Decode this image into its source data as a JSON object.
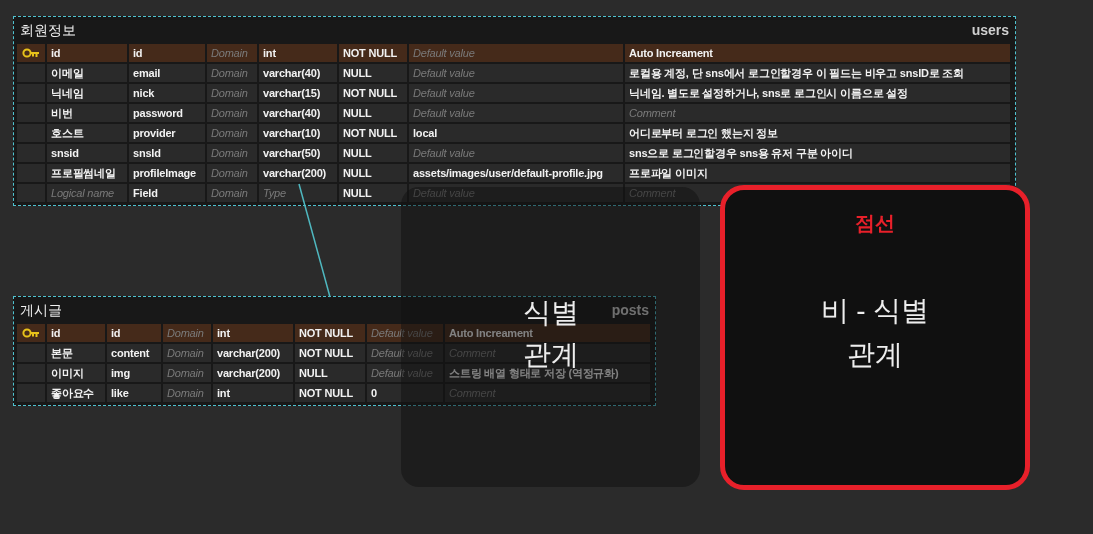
{
  "tables": [
    {
      "title": "회원정보",
      "name": "users",
      "rows": [
        {
          "primary_key": true,
          "cells": [
            {
              "text": "id"
            },
            {
              "text": "id"
            },
            {
              "text": "Domain",
              "placeholder": true
            },
            {
              "text": "int"
            },
            {
              "text": "NOT NULL"
            },
            {
              "text": "Default value",
              "placeholder": true
            },
            {
              "text": "Auto Increament"
            }
          ]
        },
        {
          "primary_key": false,
          "cells": [
            {
              "text": "이메일"
            },
            {
              "text": "email"
            },
            {
              "text": "Domain",
              "placeholder": true
            },
            {
              "text": "varchar(40)"
            },
            {
              "text": "NULL"
            },
            {
              "text": "Default value",
              "placeholder": true
            },
            {
              "text": "로컬용 계정, 단 sns에서 로그인할경우 이 필드는 비우고 snsID로 조회"
            }
          ]
        },
        {
          "primary_key": false,
          "cells": [
            {
              "text": "닉네임"
            },
            {
              "text": "nick"
            },
            {
              "text": "Domain",
              "placeholder": true
            },
            {
              "text": "varchar(15)"
            },
            {
              "text": "NOT NULL"
            },
            {
              "text": "Default value",
              "placeholder": true
            },
            {
              "text": "닉네임. 별도로 설정하거나, sns로 로그인시 이름으로 설정"
            }
          ]
        },
        {
          "primary_key": false,
          "cells": [
            {
              "text": "비번"
            },
            {
              "text": "password"
            },
            {
              "text": "Domain",
              "placeholder": true
            },
            {
              "text": "varchar(40)"
            },
            {
              "text": "NULL"
            },
            {
              "text": "Default value",
              "placeholder": true
            },
            {
              "text": "Comment",
              "placeholder": true
            }
          ]
        },
        {
          "primary_key": false,
          "cells": [
            {
              "text": "호스트"
            },
            {
              "text": "provider"
            },
            {
              "text": "Domain",
              "placeholder": true
            },
            {
              "text": "varchar(10)"
            },
            {
              "text": "NOT NULL"
            },
            {
              "text": "local"
            },
            {
              "text": "어디로부터 로그인 했는지 정보"
            }
          ]
        },
        {
          "primary_key": false,
          "cells": [
            {
              "text": "snsid"
            },
            {
              "text": "snsId"
            },
            {
              "text": "Domain",
              "placeholder": true
            },
            {
              "text": "varchar(50)"
            },
            {
              "text": "NULL"
            },
            {
              "text": "Default value",
              "placeholder": true
            },
            {
              "text": "sns으로 로그인할경우 sns용 유저 구분 아이디"
            }
          ]
        },
        {
          "primary_key": false,
          "cells": [
            {
              "text": "프로필썸네일"
            },
            {
              "text": "profileImage"
            },
            {
              "text": "Domain",
              "placeholder": true
            },
            {
              "text": "varchar(200)"
            },
            {
              "text": "NULL"
            },
            {
              "text": "assets/images/user/default-profile.jpg"
            },
            {
              "text": "프로파일 이미지"
            }
          ]
        },
        {
          "primary_key": false,
          "cells": [
            {
              "text": "Logical name",
              "placeholder": true
            },
            {
              "text": "Field"
            },
            {
              "text": "Domain",
              "placeholder": true
            },
            {
              "text": "Type",
              "placeholder": true
            },
            {
              "text": "NULL"
            },
            {
              "text": "Default value",
              "placeholder": true
            },
            {
              "text": "Comment",
              "placeholder": true
            }
          ]
        }
      ]
    },
    {
      "title": "게시글",
      "name": "posts",
      "rows": [
        {
          "primary_key": true,
          "cells": [
            {
              "text": "id"
            },
            {
              "text": "id"
            },
            {
              "text": "Domain",
              "placeholder": true
            },
            {
              "text": "int"
            },
            {
              "text": "NOT NULL"
            },
            {
              "text": "Default value",
              "placeholder": true
            },
            {
              "text": "Auto Increament"
            }
          ]
        },
        {
          "primary_key": false,
          "cells": [
            {
              "text": "본문"
            },
            {
              "text": "content"
            },
            {
              "text": "Domain",
              "placeholder": true
            },
            {
              "text": "varchar(200)"
            },
            {
              "text": "NOT NULL"
            },
            {
              "text": "Default value",
              "placeholder": true
            },
            {
              "text": "Comment",
              "placeholder": true
            }
          ]
        },
        {
          "primary_key": false,
          "cells": [
            {
              "text": "이미지"
            },
            {
              "text": "img"
            },
            {
              "text": "Domain",
              "placeholder": true
            },
            {
              "text": "varchar(200)"
            },
            {
              "text": "NULL"
            },
            {
              "text": "Default value",
              "placeholder": true
            },
            {
              "text": "스트링 배열 형태로 저장 (역정규화)"
            }
          ]
        },
        {
          "primary_key": false,
          "cells": [
            {
              "text": "좋아요수"
            },
            {
              "text": "like"
            },
            {
              "text": "Domain",
              "placeholder": true
            },
            {
              "text": "int"
            },
            {
              "text": "NOT NULL"
            },
            {
              "text": "0"
            },
            {
              "text": "Comment",
              "placeholder": true
            }
          ]
        }
      ]
    }
  ],
  "overlays": [
    {
      "kind": "plain",
      "lines": [
        "식별",
        "관계"
      ]
    },
    {
      "kind": "outlined",
      "note": "점선",
      "lines": [
        "비 - 식별",
        "관계"
      ]
    }
  ]
}
